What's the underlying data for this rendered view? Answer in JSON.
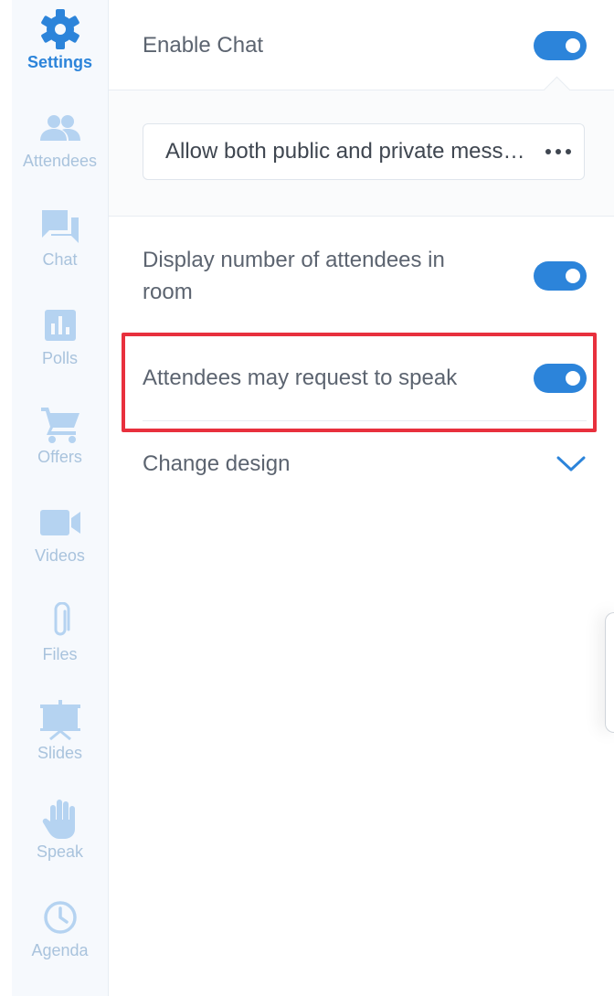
{
  "sidebar": {
    "items": [
      {
        "label": "Settings",
        "icon": "gear-icon",
        "active": true
      },
      {
        "label": "Attendees",
        "icon": "people-icon",
        "active": false
      },
      {
        "label": "Chat",
        "icon": "chat-icon",
        "active": false
      },
      {
        "label": "Polls",
        "icon": "poll-chart-icon",
        "active": false
      },
      {
        "label": "Offers",
        "icon": "cart-icon",
        "active": false
      },
      {
        "label": "Videos",
        "icon": "video-camera-icon",
        "active": false
      },
      {
        "label": "Files",
        "icon": "paperclip-icon",
        "active": false
      },
      {
        "label": "Slides",
        "icon": "presentation-icon",
        "active": false
      },
      {
        "label": "Speak",
        "icon": "hand-icon",
        "active": false
      },
      {
        "label": "Agenda",
        "icon": "clock-icon",
        "active": false
      }
    ]
  },
  "settings": {
    "enable_chat": {
      "label": "Enable Chat",
      "on": true
    },
    "chat_mode": {
      "value": "Allow both public and private messages"
    },
    "display_attendees": {
      "label": "Display number of attendees in room",
      "on": true
    },
    "request_speak": {
      "label": "Attendees may request to speak",
      "on": true
    },
    "change_design": {
      "label": "Change design"
    }
  },
  "colors": {
    "accent": "#2c84da",
    "icon_inactive": "#b5d3f1",
    "label_inactive": "#a9c3dd",
    "highlight": "#e8303d",
    "text": "#5c6470"
  }
}
